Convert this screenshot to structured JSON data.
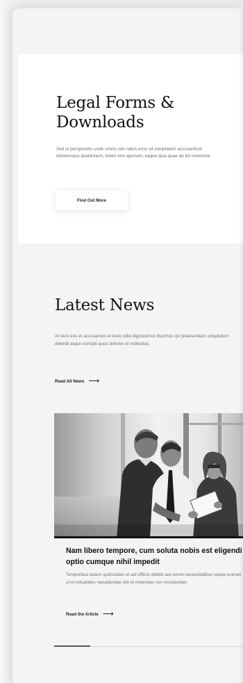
{
  "hero": {
    "title": "Legal Forms & Downloads",
    "text": "Sed ut perspiciatis unde omnis iste natus error sit voluptatem accusantium doloremque laudantium, totam rem aperiam, eaque ipsa quae ab illo inventore.",
    "button_label": "Find Out More"
  },
  "news": {
    "title": "Latest News",
    "text": "At vero eos et accusamus et iusto odio dignissimos ducimus qui praesentium voluptatum deleniti atque corrupti quos dolores et molestias.",
    "read_all_label": "Read All News",
    "arrow": "⟶"
  },
  "article": {
    "title": "Nam libero tempore, cum soluta nobis est eligendi optio cumque nihil impedit",
    "text": "Temporibus autem quibusdam et aut officiis debitis aut rerum necessitatibus saepe eveniet ut et voluptates repudiandae sint et molestiae non recusandae.",
    "read_label": "Read the Article",
    "arrow": "⟶"
  },
  "slider": {
    "progress": 0.19
  },
  "colors": {
    "text": "#111111",
    "muted": "#707070",
    "card": "#f4f4f4",
    "hero": "#ffffff"
  }
}
